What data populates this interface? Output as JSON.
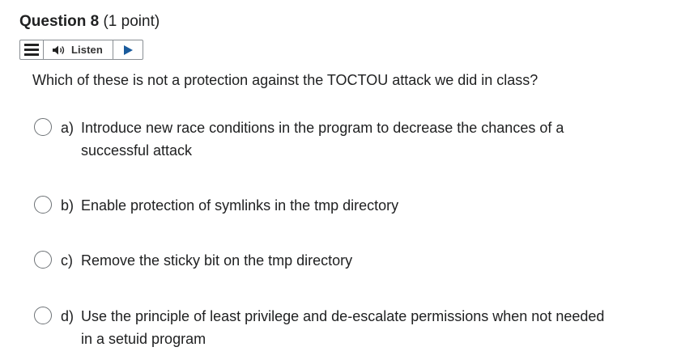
{
  "question": {
    "title": "Question 8",
    "points": "(1 point)",
    "prompt": "Which of these is not a protection against the TOCTOU attack we did in class?"
  },
  "listen_bar": {
    "menu_icon": "hamburger-menu-icon",
    "speaker_icon": "speaker-icon",
    "label": "Listen",
    "play_icon": "play-icon"
  },
  "options": [
    {
      "letter": "a)",
      "text": "Introduce new race conditions in the program to decrease the chances of a successful attack",
      "selected": false
    },
    {
      "letter": "b)",
      "text": "Enable protection of symlinks in the tmp directory",
      "selected": false
    },
    {
      "letter": "c)",
      "text": "Remove the sticky bit on the tmp directory",
      "selected": false
    },
    {
      "letter": "d)",
      "text": "Use the principle of least privilege and de-escalate permissions when not needed in a setuid program",
      "selected": false
    }
  ]
}
